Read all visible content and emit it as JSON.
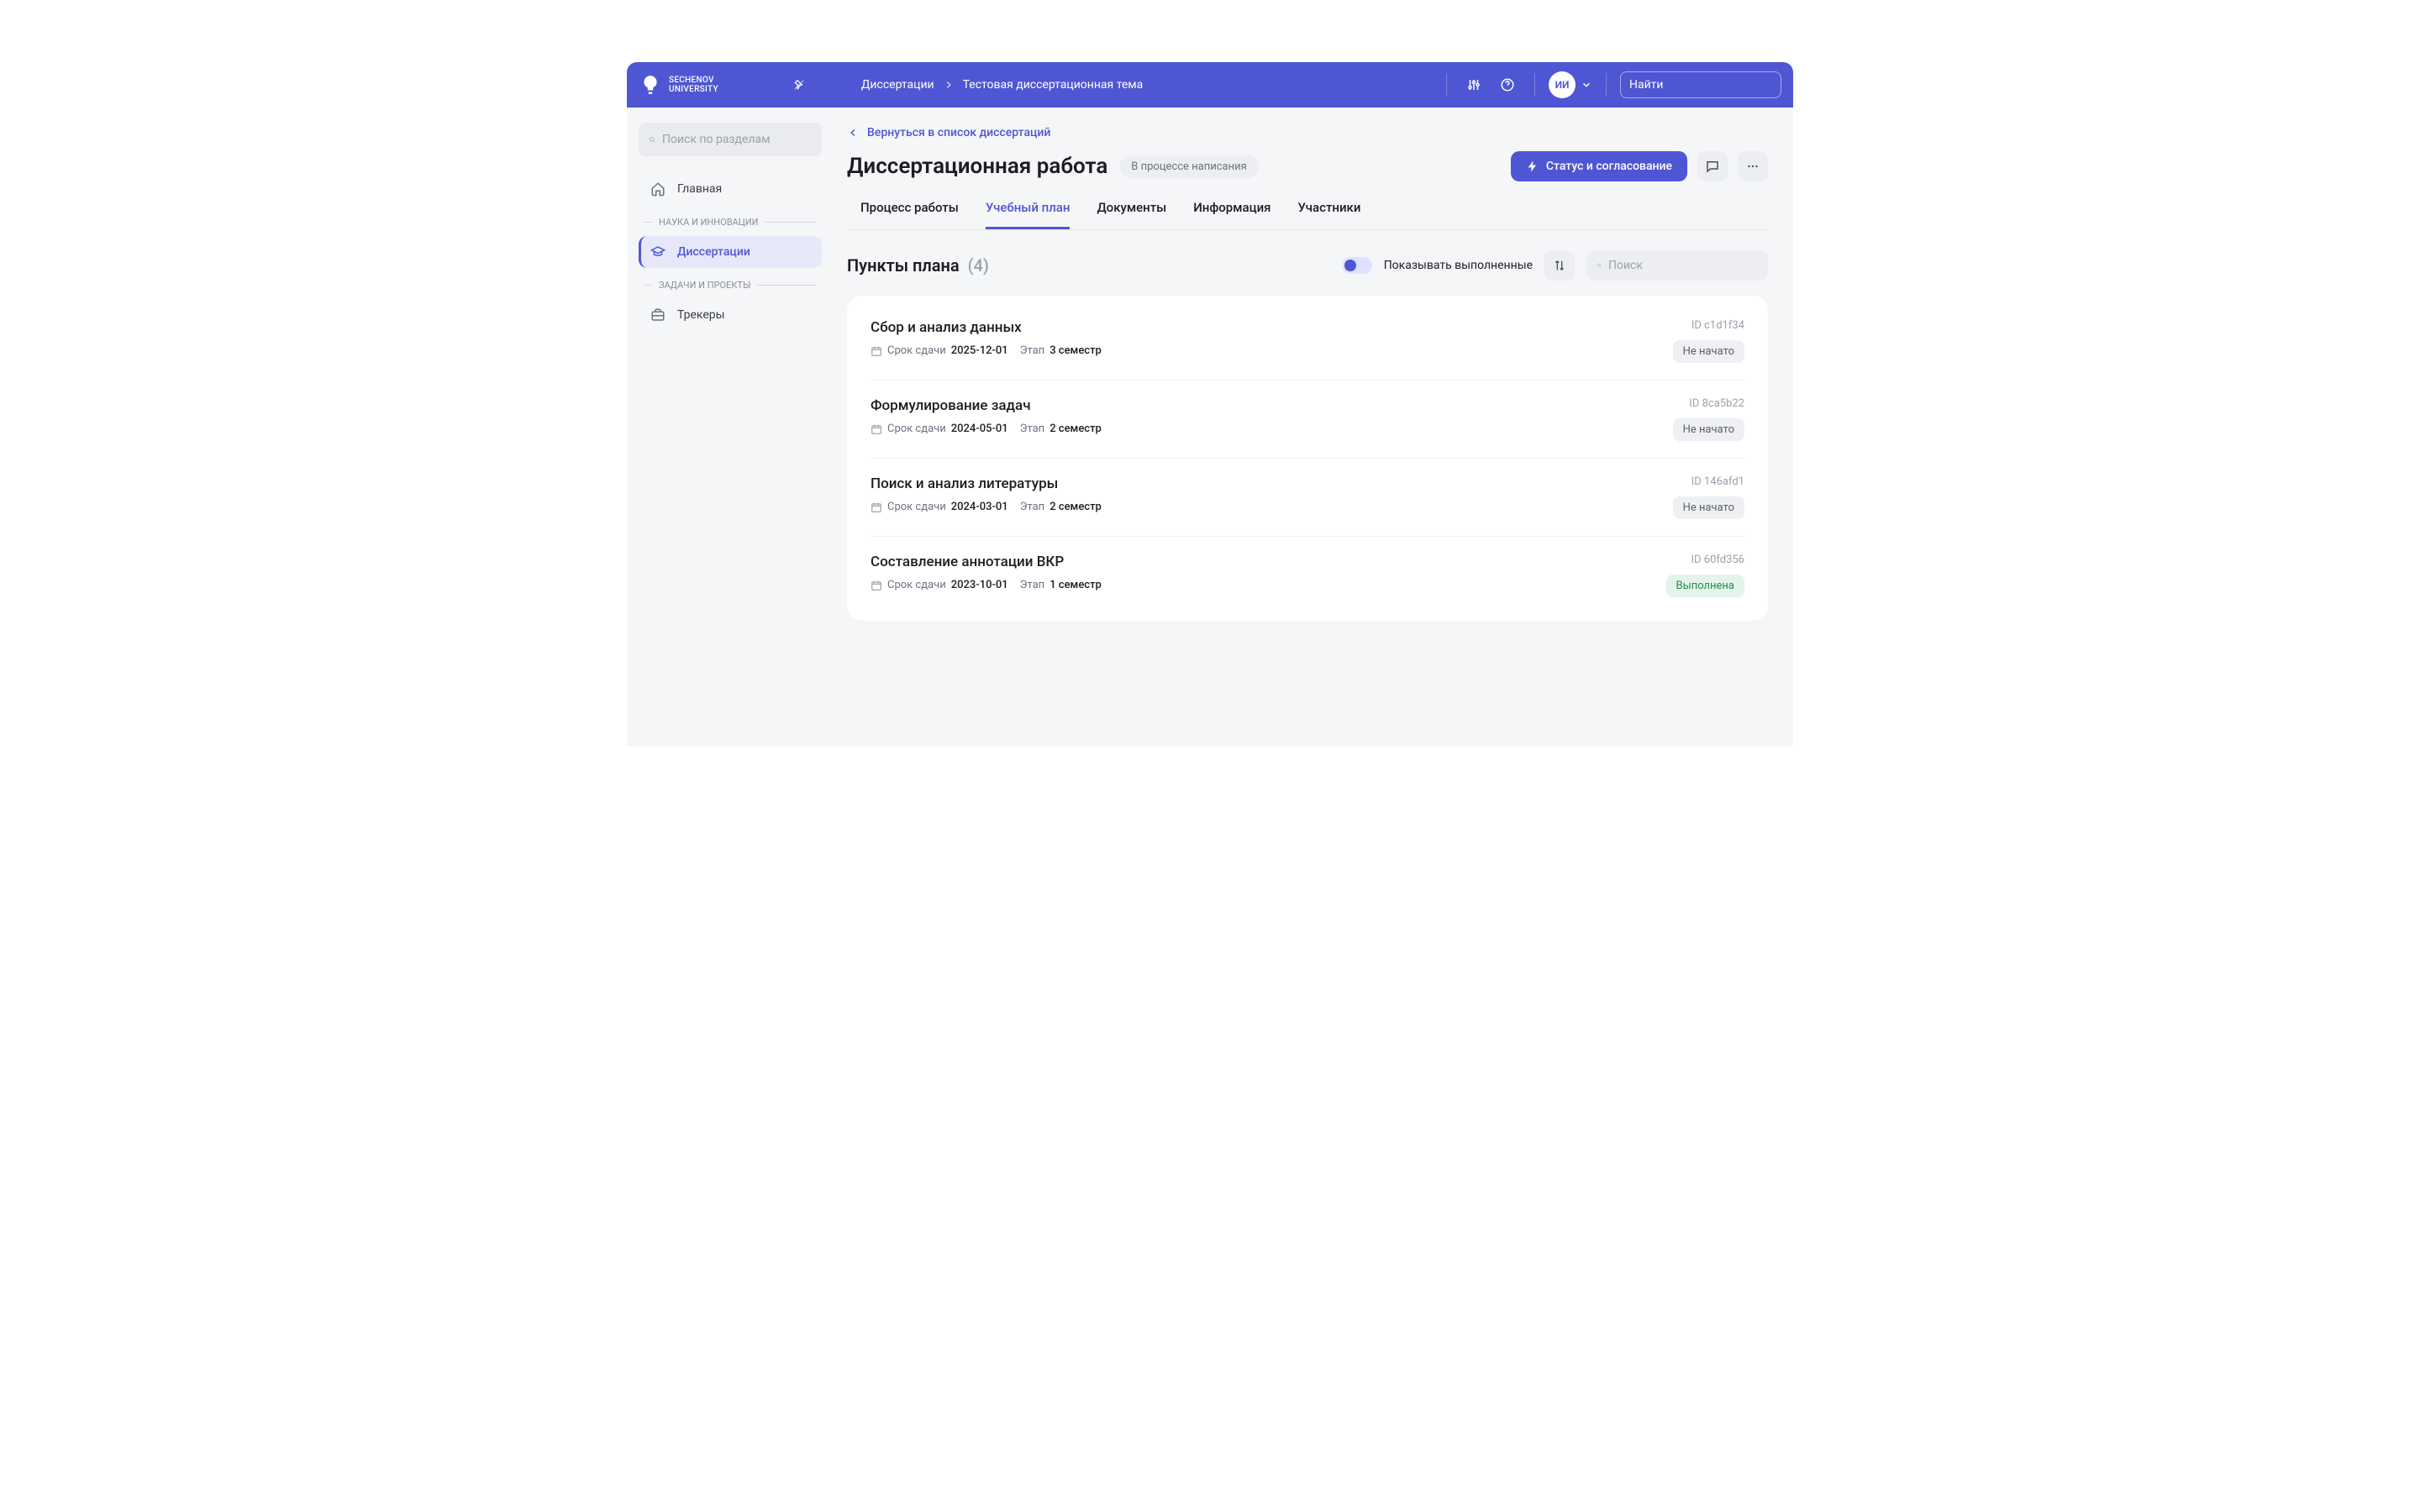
{
  "brand": {
    "name": "SECHENOV",
    "sub": "UNIVERSITY"
  },
  "breadcrumb": {
    "root": "Диссертации",
    "leaf": "Тестовая диссертационная тема"
  },
  "user": {
    "initials": "ИИ"
  },
  "topSearch": {
    "placeholder": "Найти"
  },
  "sidebar": {
    "searchPlaceholder": "Поиск по разделам",
    "items": [
      {
        "label": "Главная",
        "icon": "home"
      },
      {
        "section": "НАУКА И ИННОВАЦИИ"
      },
      {
        "label": "Диссертации",
        "icon": "cap",
        "active": true
      },
      {
        "section": "ЗАДАЧИ И ПРОЕКТЫ"
      },
      {
        "label": "Трекеры",
        "icon": "briefcase"
      }
    ]
  },
  "back": {
    "label": "Вернуться в список диссертаций"
  },
  "page": {
    "title": "Диссертационная работа",
    "status": "В процессе написания"
  },
  "actions": {
    "primary": "Статус и согласование"
  },
  "tabs": [
    "Процесс работы",
    "Учебный план",
    "Документы",
    "Информация",
    "Участники"
  ],
  "activeTab": 1,
  "section": {
    "title": "Пункты плана",
    "count": "(4)",
    "toggleLabel": "Показывать выполненные",
    "searchPlaceholder": "Поиск"
  },
  "labels": {
    "due": "Срок сдачи",
    "stage": "Этап",
    "idPrefix": "ID"
  },
  "items": [
    {
      "title": "Сбор и анализ данных",
      "due": "2025-12-01",
      "stage": "3 семестр",
      "id": "c1d1f34",
      "status": "Не начато",
      "statusClass": "st-gray"
    },
    {
      "title": "Формулирование задач",
      "due": "2024-05-01",
      "stage": "2 семестр",
      "id": "8ca5b22",
      "status": "Не начато",
      "statusClass": "st-gray"
    },
    {
      "title": "Поиск и анализ литературы",
      "due": "2024-03-01",
      "stage": "2 семестр",
      "id": "146afd1",
      "status": "Не начато",
      "statusClass": "st-gray"
    },
    {
      "title": "Составление аннотации ВКР",
      "due": "2023-10-01",
      "stage": "1 семестр",
      "id": "60fd356",
      "status": "Выполнена",
      "statusClass": "st-green"
    }
  ]
}
